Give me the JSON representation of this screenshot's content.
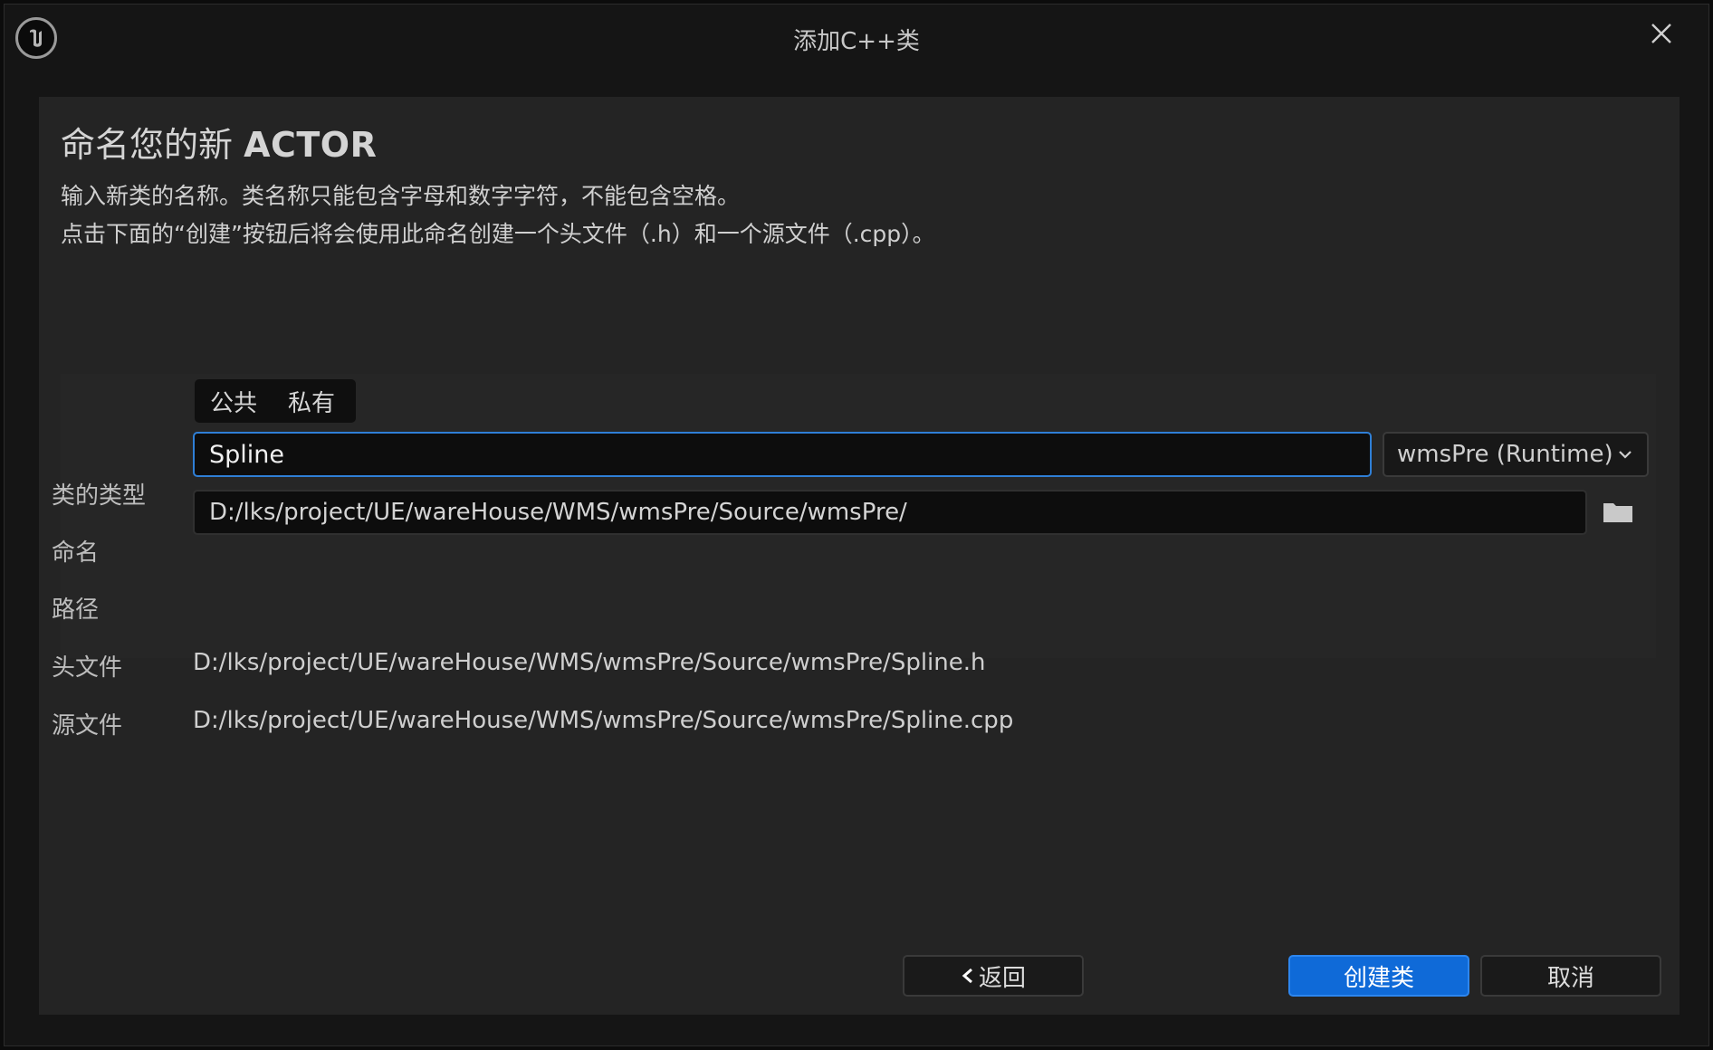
{
  "window": {
    "title": "添加C++类"
  },
  "header": {
    "heading_prefix": "命名您的新 ",
    "heading_type": "ACTOR",
    "description_line1": "输入新类的名称。类名称只能包含字母和数字字符，不能包含空格。",
    "description_line2": "点击下面的“创建”按钮后将会使用此命名创建一个头文件（.h）和一个源文件（.cpp）。"
  },
  "form": {
    "class_type_label": "类的类型",
    "class_type_options": [
      "公共",
      "私有"
    ],
    "name_label": "命名",
    "name_value": "Spline",
    "module_value": "wmsPre (Runtime)",
    "path_label": "路径",
    "path_value": "D:/lks/project/UE/wareHouse/WMS/wmsPre/Source/wmsPre/",
    "header_label": "头文件",
    "header_value": "D:/lks/project/UE/wareHouse/WMS/wmsPre/Source/wmsPre/Spline.h",
    "source_label": "源文件",
    "source_value": "D:/lks/project/UE/wareHouse/WMS/wmsPre/Source/wmsPre/Spline.cpp"
  },
  "buttons": {
    "back_label": "返回",
    "create_label": "创建类",
    "cancel_label": "取消"
  },
  "colors": {
    "accent": "#0f6ad8",
    "focus_border": "#2f7fd6",
    "panel_bg": "#242424",
    "window_bg": "#151515"
  },
  "icons": {
    "logo": "unreal-engine-logo-icon",
    "close": "close-icon",
    "dropdown": "chevron-down-icon",
    "folder": "folder-icon",
    "back": "chevron-left-icon"
  }
}
